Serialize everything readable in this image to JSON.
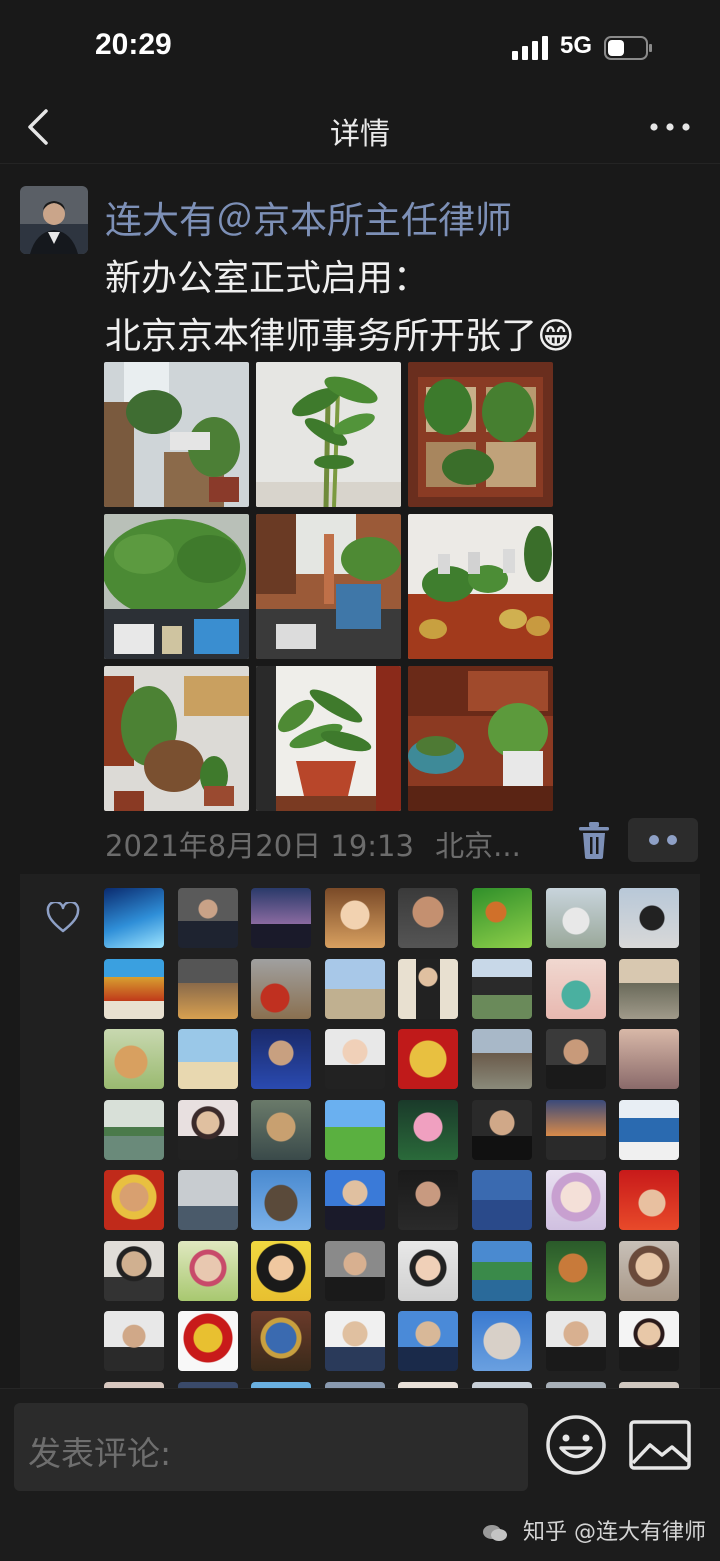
{
  "status_bar": {
    "time": "20:29",
    "network": "5G"
  },
  "nav": {
    "title": "详情"
  },
  "post": {
    "author": "连大有＠京本所主任律师",
    "content_lines": [
      "新办公室正式启用：",
      "北京京本律师事务所开张了😁"
    ],
    "timestamp": "2021年8月20日 19:13",
    "location": "北京..."
  },
  "comment_input": {
    "placeholder": "发表评论:"
  },
  "watermark": {
    "text": "知乎 @连大有律师"
  }
}
